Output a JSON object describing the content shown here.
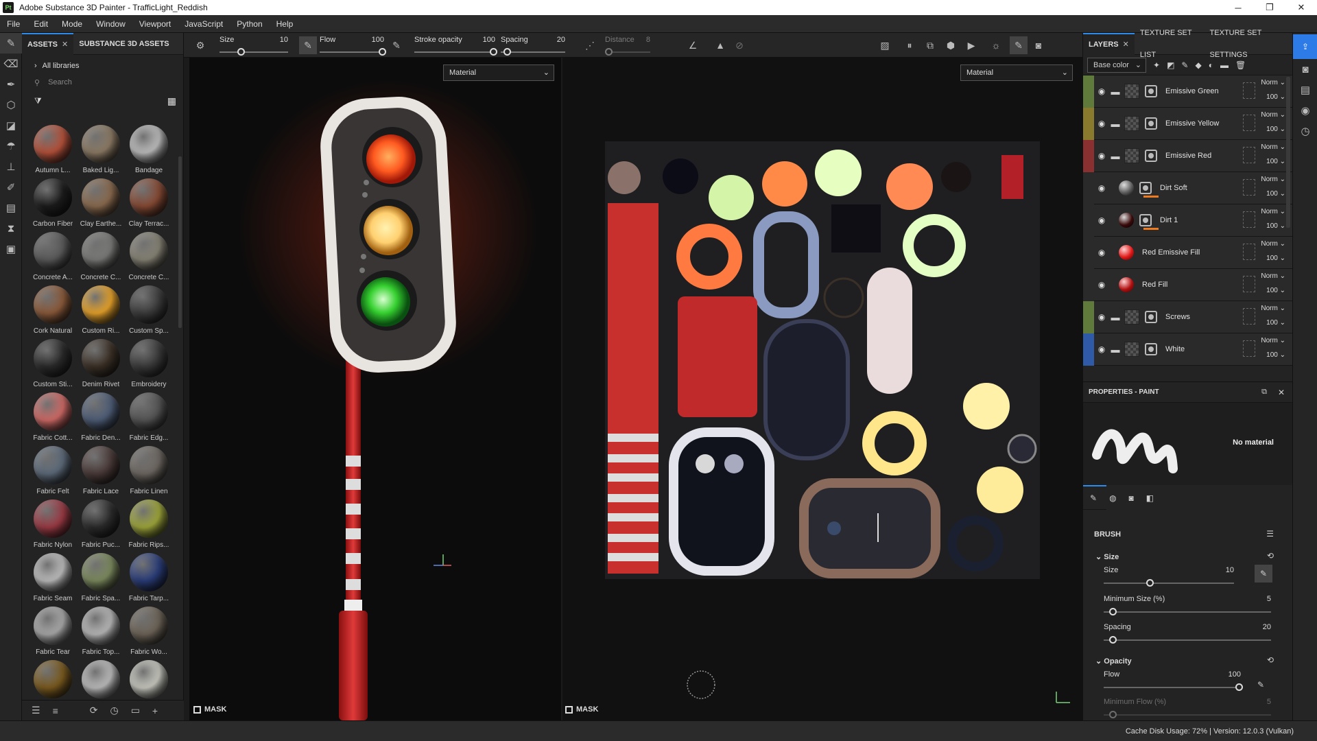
{
  "window": {
    "logo": "Pt",
    "title": "Adobe Substance 3D Painter - TrafficLight_Reddish",
    "controls": [
      "─",
      "❐",
      "✕"
    ]
  },
  "menu": [
    "File",
    "Edit",
    "Mode",
    "Window",
    "Viewport",
    "JavaScript",
    "Python",
    "Help"
  ],
  "assets_panel": {
    "tabs": [
      "ASSETS",
      "SUBSTANCE 3D ASSETS"
    ],
    "library": "All libraries",
    "search_placeholder": "Search",
    "items": [
      {
        "label": "Autumn L...",
        "color": "#b5513a"
      },
      {
        "label": "Baked Lig...",
        "color": "#8c7a64"
      },
      {
        "label": "Bandage",
        "color": "#bdbdbd"
      },
      {
        "label": "Carbon Fiber",
        "color": "#1c1c1c"
      },
      {
        "label": "Clay Earthe...",
        "color": "#8a6a4e"
      },
      {
        "label": "Clay Terrac...",
        "color": "#874a34"
      },
      {
        "label": "Concrete A...",
        "color": "#5b5b5b"
      },
      {
        "label": "Concrete C...",
        "color": "#7a7a78"
      },
      {
        "label": "Concrete C...",
        "color": "#868375"
      },
      {
        "label": "Cork Natural",
        "color": "#8b5a3a"
      },
      {
        "label": "Custom Ri...",
        "color": "#e6a22a"
      },
      {
        "label": "Custom Sp...",
        "color": "#3c3c3c"
      },
      {
        "label": "Custom Sti...",
        "color": "#2a2a2a"
      },
      {
        "label": "Denim Rivet",
        "color": "#3b3026"
      },
      {
        "label": "Embroidery",
        "color": "#3a3a3a"
      },
      {
        "label": "Fabric Cott...",
        "color": "#d06a66"
      },
      {
        "label": "Fabric Den...",
        "color": "#4e5d77"
      },
      {
        "label": "Fabric Edg...",
        "color": "#555555"
      },
      {
        "label": "Fabric Felt",
        "color": "#5d6a7a"
      },
      {
        "label": "Fabric Lace",
        "color": "#4a3a38"
      },
      {
        "label": "Fabric Linen",
        "color": "#6e6862"
      },
      {
        "label": "Fabric Nylon",
        "color": "#9b3a44"
      },
      {
        "label": "Fabric Puc...",
        "color": "#2b2b2b"
      },
      {
        "label": "Fabric Rips...",
        "color": "#9ea63a"
      },
      {
        "label": "Fabric Seam",
        "color": "#bdbdbd"
      },
      {
        "label": "Fabric Spa...",
        "color": "#7c8a5e"
      },
      {
        "label": "Fabric Tarp...",
        "color": "#2a3d7a"
      },
      {
        "label": "Fabric Tear",
        "color": "#a9a9a9"
      },
      {
        "label": "Fabric Top...",
        "color": "#b8b8b8"
      },
      {
        "label": "Fabric Wo...",
        "color": "#6d6458"
      },
      {
        "label": "",
        "color": "#7a5a1e"
      },
      {
        "label": "",
        "color": "#bcbcbc"
      },
      {
        "label": "",
        "color": "#c8c8c0"
      }
    ]
  },
  "toolbar": {
    "size_label": "Size",
    "size_value": "10",
    "flow_label": "Flow",
    "flow_value": "100",
    "stroke_label": "Stroke opacity",
    "stroke_value": "100",
    "spacing_label": "Spacing",
    "spacing_value": "20",
    "distance_label": "Distance",
    "distance_value": "8"
  },
  "viewports": {
    "left_mode": "Material",
    "right_mode": "Material",
    "mask_label": "MASK"
  },
  "layers_panel": {
    "tabs": [
      "LAYERS",
      "TEXTURE SET LIST",
      "TEXTURE SET SETTINGS"
    ],
    "channel": "Base color",
    "layers": [
      {
        "name": "Emissive Green",
        "blend": "Norm",
        "opacity": "100",
        "color": "#5f7a3a",
        "kind": "folder"
      },
      {
        "name": "Emissive Yellow",
        "blend": "Norm",
        "opacity": "100",
        "color": "#8a7a2e",
        "kind": "folder"
      },
      {
        "name": "Emissive Red",
        "blend": "Norm",
        "opacity": "100",
        "color": "#8a3030",
        "kind": "folder"
      },
      {
        "name": "Dirt Soft",
        "blend": "Norm",
        "opacity": "100",
        "color": "#2a2a2a",
        "kind": "sphere",
        "sphere": "#5a5a5a"
      },
      {
        "name": "Dirt 1",
        "blend": "Norm",
        "opacity": "100",
        "color": "#2a2a2a",
        "kind": "sphere",
        "sphere": "#3a0a0a"
      },
      {
        "name": "Red Emissive Fill",
        "blend": "Norm",
        "opacity": "100",
        "color": "#2a2a2a",
        "kind": "fill",
        "sphere": "#e01818"
      },
      {
        "name": "Red Fill",
        "blend": "Norm",
        "opacity": "100",
        "color": "#2a2a2a",
        "kind": "fill",
        "sphere": "#b01010"
      },
      {
        "name": "Screws",
        "blend": "Norm",
        "opacity": "100",
        "color": "#5f7a3a",
        "kind": "folder"
      },
      {
        "name": "White",
        "blend": "Norm",
        "opacity": "100",
        "color": "#2e5aa8",
        "kind": "folder"
      }
    ]
  },
  "properties": {
    "title": "PROPERTIES - PAINT",
    "no_material": "No material",
    "brush": "BRUSH",
    "size_section": "Size",
    "size_label": "Size",
    "size_value": "10",
    "min_size_label": "Minimum Size (%)",
    "min_size_value": "5",
    "spacing_label": "Spacing",
    "spacing_value": "20",
    "opacity_section": "Opacity",
    "flow_label": "Flow",
    "flow_value": "100",
    "min_flow_label": "Minimum Flow (%)",
    "min_flow_value": "5"
  },
  "status": {
    "text": "Cache Disk Usage:    72% | Version: 12.0.3 (Vulkan)"
  }
}
